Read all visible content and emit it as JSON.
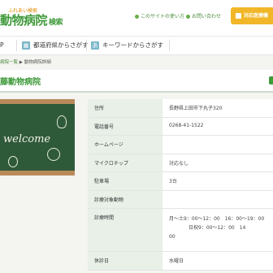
{
  "header": {
    "logo_small": "ふれあい検索",
    "logo_main": "動物病院",
    "logo_suffix": "検索",
    "links": [
      "このサイトの使い方",
      "お問い合わせ"
    ],
    "hospital_button": "対応医療機"
  },
  "nav": {
    "items": [
      {
        "label": "P",
        "icon": "map-icon"
      },
      {
        "label": "都道府県からさがす",
        "icon": "map-icon"
      },
      {
        "label": "キーワードからさがす",
        "icon": "keyword-icon"
      }
    ]
  },
  "breadcrumb": {
    "link": "病院一覧",
    "separator": "▶",
    "current": "動物病院詳細"
  },
  "page": {
    "title": "藤動物病院"
  },
  "photo": {
    "text": "welcome"
  },
  "info": {
    "rows": [
      {
        "label": "住所",
        "value": "長野県上田市下丸子320"
      },
      {
        "label": "電話番号",
        "value": "0268-41-1522"
      },
      {
        "label": "ホームページ",
        "value": ""
      },
      {
        "label": "マイクロチップ",
        "value": "対応なし"
      },
      {
        "label": "駐車場",
        "value": "3台"
      },
      {
        "label": "診療対象動物",
        "value": ""
      },
      {
        "label": "診療時間",
        "value_lines": [
          "月〜土9：00〜12：00　16：00〜19：00",
          "　　　　日祝9：00〜12：00　14",
          "00"
        ]
      },
      {
        "label": "休診日",
        "value": "水曜日"
      }
    ]
  }
}
